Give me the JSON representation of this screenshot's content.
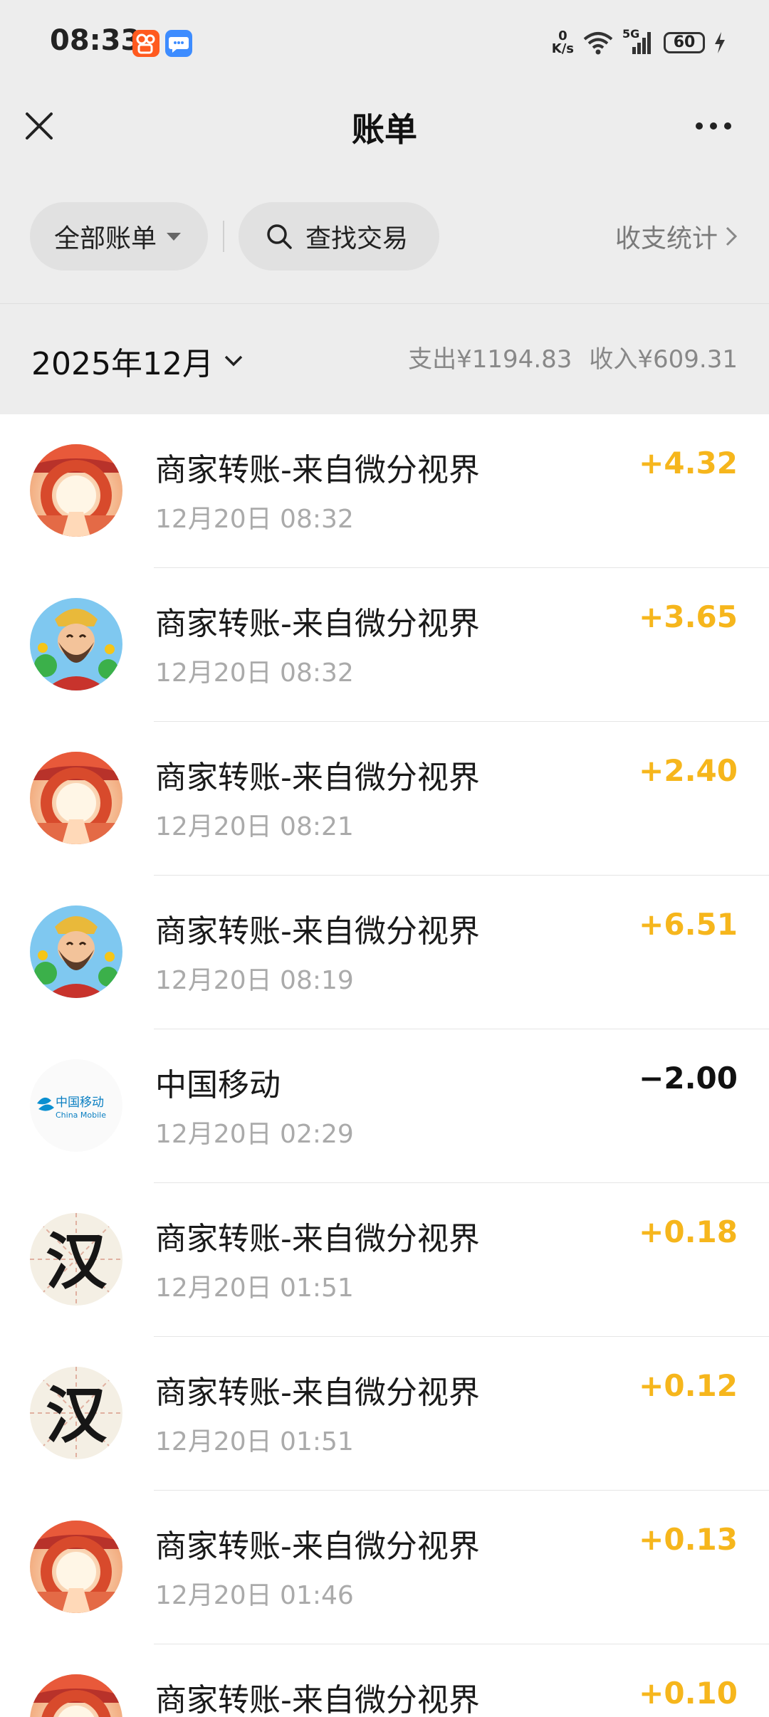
{
  "status_bar": {
    "time": "08:33",
    "net_speed_value": "0",
    "net_speed_unit": "K/s",
    "network": "5G",
    "battery": "60",
    "icons": [
      "kuaishou-app-icon",
      "message-app-icon",
      "wifi-icon",
      "signal-icon",
      "battery-icon",
      "charging-icon"
    ]
  },
  "header": {
    "title": "账单",
    "close_icon": "close-icon",
    "more_icon": "more-icon"
  },
  "filters": {
    "all_bills": "全部账单",
    "search": "查找交易",
    "stats": "收支统计"
  },
  "month": {
    "label": "2025年12月",
    "expense": "支出¥1194.83",
    "income": "收入¥609.31"
  },
  "colors": {
    "income_amount": "#f6b61c",
    "expense_amount": "#111111",
    "page_bg": "#ededed",
    "list_bg": "#ffffff"
  },
  "transactions": [
    {
      "name": "商家转账-来自微分视界",
      "time": "12月20日 08:32",
      "amount": "+4.32",
      "type": "income",
      "avatar": "gate-avatar"
    },
    {
      "name": "商家转账-来自微分视界",
      "time": "12月20日 08:32",
      "amount": "+3.65",
      "type": "income",
      "avatar": "god-of-wealth-avatar"
    },
    {
      "name": "商家转账-来自微分视界",
      "time": "12月20日 08:21",
      "amount": "+2.40",
      "type": "income",
      "avatar": "gate-avatar"
    },
    {
      "name": "商家转账-来自微分视界",
      "time": "12月20日 08:19",
      "amount": "+6.51",
      "type": "income",
      "avatar": "god-of-wealth-avatar"
    },
    {
      "name": "中国移动",
      "time": "12月20日 02:29",
      "amount": "−2.00",
      "type": "expense",
      "avatar": "china-mobile-logo",
      "logo_text_cn": "中国移动",
      "logo_text_en": "China Mobile"
    },
    {
      "name": "商家转账-来自微分视界",
      "time": "12月20日 01:51",
      "amount": "+0.18",
      "type": "income",
      "avatar": "calligraphy-avatar",
      "avatar_char": "汉"
    },
    {
      "name": "商家转账-来自微分视界",
      "time": "12月20日 01:51",
      "amount": "+0.12",
      "type": "income",
      "avatar": "calligraphy-avatar",
      "avatar_char": "汉"
    },
    {
      "name": "商家转账-来自微分视界",
      "time": "12月20日 01:46",
      "amount": "+0.13",
      "type": "income",
      "avatar": "gate-avatar"
    },
    {
      "name": "商家转账-来自微分视界",
      "time": "",
      "amount": "+0.10",
      "type": "income",
      "avatar": "gate-avatar"
    }
  ]
}
